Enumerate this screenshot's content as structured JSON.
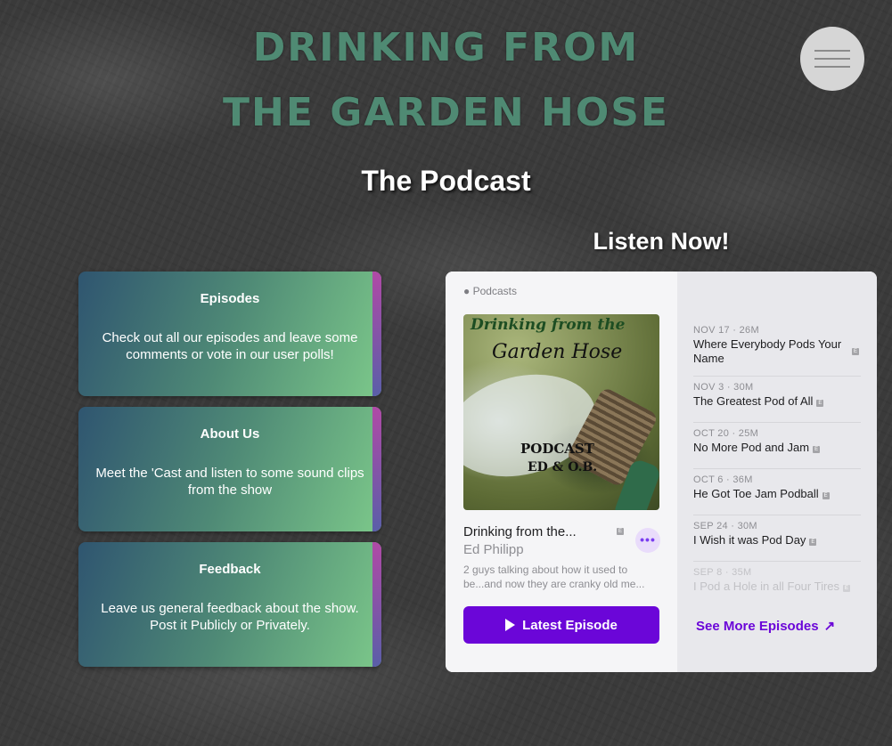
{
  "header": {
    "title_line1": "DRINKING FROM",
    "title_line2": "THE GARDEN HOSE",
    "subtitle": "The Podcast",
    "menu_icon": "hamburger-icon"
  },
  "nav_cards": [
    {
      "title": "Episodes",
      "body": "Check out all our episodes and leave some comments or vote in our user polls!"
    },
    {
      "title": "About Us",
      "body": "Meet the 'Cast and listen to some sound clips from the show"
    },
    {
      "title": "Feedback",
      "body": "Leave us general feedback about the show. Post it Publicly or Privately."
    }
  ],
  "listen_now": "Listen Now!",
  "widget": {
    "brand": "Podcasts",
    "brand_icon": "apple-icon",
    "artwork": {
      "line1": "Drinking from the",
      "line2": "Garden Hose",
      "line3": "PODCAST",
      "line4": "ED & O.B."
    },
    "podcast_name": "Drinking from the...",
    "author": "Ed Philipp",
    "description": "2 guys talking about how it used to be...and now they are cranky old me...",
    "explicit_mark": "E",
    "more_label": "•••",
    "latest_button": "Latest Episode",
    "see_more": "See More Episodes",
    "episodes": [
      {
        "meta": "NOV 17 · 26M",
        "title": "Where Everybody Pods Your Name"
      },
      {
        "meta": "NOV 3 · 30M",
        "title": "The Greatest Pod of All"
      },
      {
        "meta": "OCT 20 · 25M",
        "title": "No More Pod and Jam"
      },
      {
        "meta": "OCT 6 · 36M",
        "title": "He Got Toe Jam Podball"
      },
      {
        "meta": "SEP 24 · 30M",
        "title": "I Wish it was Pod Day"
      },
      {
        "meta": "SEP 8 · 35M",
        "title": "I Pod a Hole in all Four Tires"
      }
    ]
  },
  "colors": {
    "title_green": "#4f8a73",
    "accent_purple": "#6b06d8",
    "card_gradient_start": "#2f5570",
    "card_gradient_end": "#7cc88a"
  }
}
